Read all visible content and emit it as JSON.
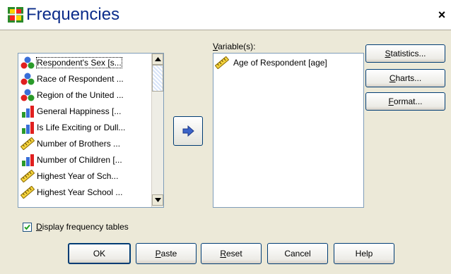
{
  "window": {
    "title": "Frequencies",
    "close_label": "×"
  },
  "variable_list": {
    "items": [
      {
        "label": "Respondent's Sex [s...",
        "icon": "nominal-icon",
        "selected": true
      },
      {
        "label": "Race of Respondent ...",
        "icon": "nominal-icon"
      },
      {
        "label": "Region of the United ...",
        "icon": "nominal-icon"
      },
      {
        "label": "General Happiness [...",
        "icon": "ordinal-icon"
      },
      {
        "label": "Is Life Exciting or Dull...",
        "icon": "ordinal-icon"
      },
      {
        "label": "Number of Brothers ...",
        "icon": "scale-icon"
      },
      {
        "label": "Number of Children [...",
        "icon": "ordinal-icon"
      },
      {
        "label": "Highest Year of Sch...",
        "icon": "scale-icon"
      },
      {
        "label": "Highest Year School ...",
        "icon": "scale-icon"
      }
    ]
  },
  "move_button": {
    "icon": "right-arrow-icon"
  },
  "selected_variables": {
    "label_prefix": "V",
    "label_rest": "ariable(s):",
    "items": [
      {
        "label": "Age of Respondent [age]",
        "icon": "scale-icon"
      }
    ]
  },
  "side_buttons": {
    "statistics": {
      "u": "S",
      "rest": "tatistics..."
    },
    "charts": {
      "u": "C",
      "rest": "harts..."
    },
    "format": {
      "u": "F",
      "rest": "ormat..."
    }
  },
  "display_tables": {
    "u": "D",
    "rest": "isplay frequency tables",
    "checked": true
  },
  "bottom_buttons": {
    "ok": "OK",
    "paste": {
      "u": "P",
      "rest": "aste"
    },
    "reset": {
      "u": "R",
      "rest": "eset"
    },
    "cancel": "Cancel",
    "help": "Help"
  },
  "colors": {
    "title": "#0b2c8a",
    "accent_border": "#003c74",
    "dialog_bg": "#ece9d8"
  }
}
